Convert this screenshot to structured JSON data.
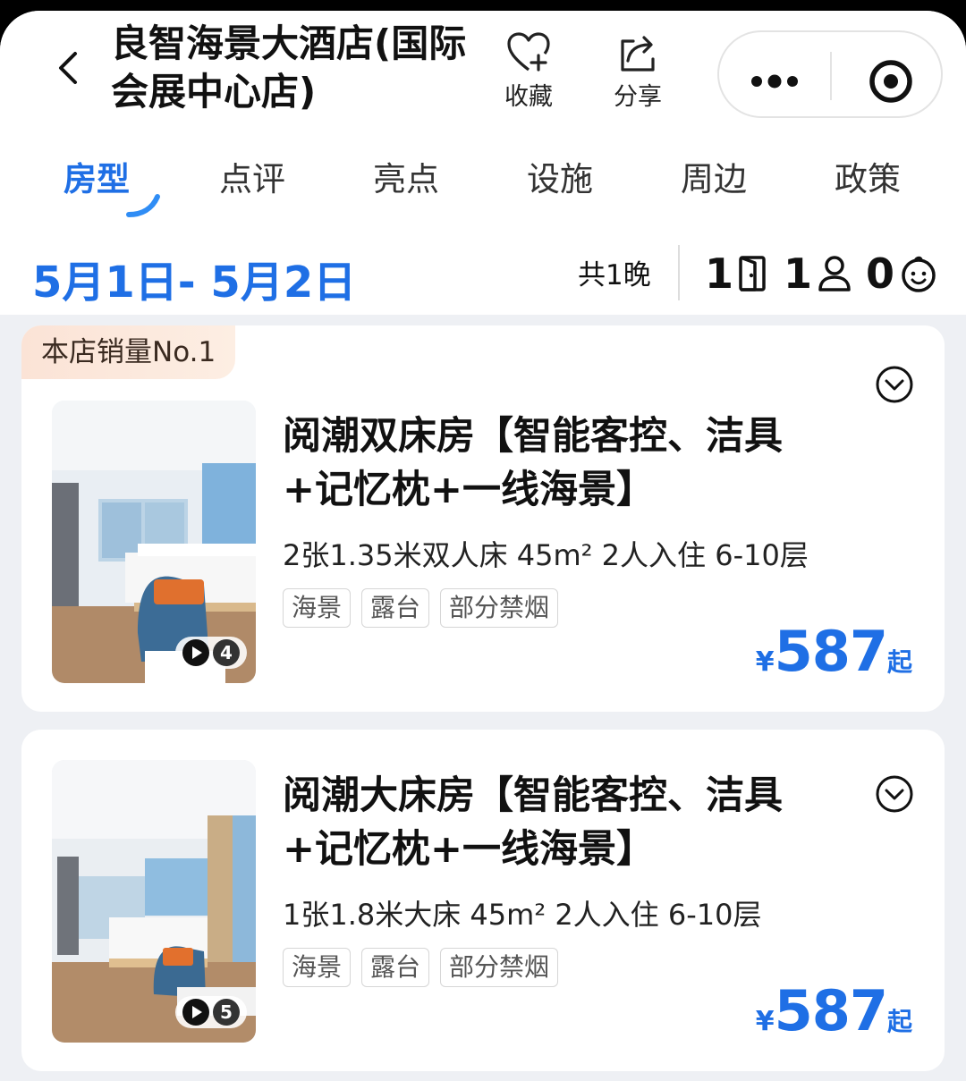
{
  "header": {
    "back_icon": "chevron-left-icon",
    "hotel_name": "良智海景大酒店(国际会展中心店)",
    "favorite_label": "收藏",
    "favorite_icon": "heart-plus-icon",
    "share_label": "分享",
    "share_icon": "share-icon",
    "capsule": {
      "more_icon": "more-dots-icon",
      "close_icon": "target-close-icon"
    }
  },
  "tabs": [
    {
      "label": "房型",
      "active": true
    },
    {
      "label": "点评",
      "active": false
    },
    {
      "label": "亮点",
      "active": false
    },
    {
      "label": "设施",
      "active": false
    },
    {
      "label": "周边",
      "active": false
    },
    {
      "label": "政策",
      "active": false
    }
  ],
  "booking": {
    "date_range": "5月1日- 5月2日",
    "nights": "共1晚",
    "rooms_count": "1",
    "adults_count": "1",
    "children_count": "0",
    "rooms_icon": "door-icon",
    "adults_icon": "person-icon",
    "children_icon": "child-face-icon"
  },
  "rooms": [
    {
      "badge": "本店销量No.1",
      "name": "阅潮双床房【智能客控、洁具+记忆枕+一线海景】",
      "spec": "2张1.35米双人床 45m² 2人入住 6-10层",
      "tags": [
        "海景",
        "露台",
        "部分禁烟"
      ],
      "photo_count": "4",
      "currency": "¥",
      "price": "587",
      "price_suffix": "起"
    },
    {
      "badge": "",
      "name": "阅潮大床房【智能客控、洁具+记忆枕+一线海景】",
      "spec": "1张1.8米大床 45m² 2人入住 6-10层",
      "tags": [
        "海景",
        "露台",
        "部分禁烟"
      ],
      "photo_count": "5",
      "currency": "¥",
      "price": "587",
      "price_suffix": "起"
    }
  ],
  "colors": {
    "accent": "#1f6fe5",
    "background": "#eef0f4",
    "badge_bg": "#fbe3d6"
  }
}
